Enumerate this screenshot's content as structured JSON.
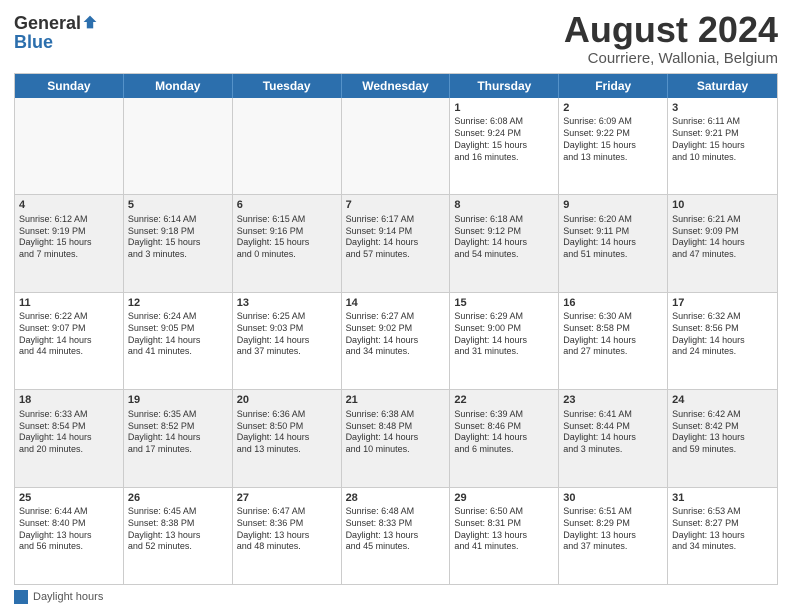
{
  "logo": {
    "general": "General",
    "blue": "Blue"
  },
  "title": {
    "month_year": "August 2024",
    "location": "Courriere, Wallonia, Belgium"
  },
  "header_days": [
    "Sunday",
    "Monday",
    "Tuesday",
    "Wednesday",
    "Thursday",
    "Friday",
    "Saturday"
  ],
  "weeks": [
    [
      {
        "day": "",
        "info": "",
        "empty": true
      },
      {
        "day": "",
        "info": "",
        "empty": true
      },
      {
        "day": "",
        "info": "",
        "empty": true
      },
      {
        "day": "",
        "info": "",
        "empty": true
      },
      {
        "day": "1",
        "info": "Sunrise: 6:08 AM\nSunset: 9:24 PM\nDaylight: 15 hours\nand 16 minutes."
      },
      {
        "day": "2",
        "info": "Sunrise: 6:09 AM\nSunset: 9:22 PM\nDaylight: 15 hours\nand 13 minutes."
      },
      {
        "day": "3",
        "info": "Sunrise: 6:11 AM\nSunset: 9:21 PM\nDaylight: 15 hours\nand 10 minutes."
      }
    ],
    [
      {
        "day": "4",
        "info": "Sunrise: 6:12 AM\nSunset: 9:19 PM\nDaylight: 15 hours\nand 7 minutes.",
        "shade": true
      },
      {
        "day": "5",
        "info": "Sunrise: 6:14 AM\nSunset: 9:18 PM\nDaylight: 15 hours\nand 3 minutes.",
        "shade": true
      },
      {
        "day": "6",
        "info": "Sunrise: 6:15 AM\nSunset: 9:16 PM\nDaylight: 15 hours\nand 0 minutes.",
        "shade": true
      },
      {
        "day": "7",
        "info": "Sunrise: 6:17 AM\nSunset: 9:14 PM\nDaylight: 14 hours\nand 57 minutes.",
        "shade": true
      },
      {
        "day": "8",
        "info": "Sunrise: 6:18 AM\nSunset: 9:12 PM\nDaylight: 14 hours\nand 54 minutes.",
        "shade": true
      },
      {
        "day": "9",
        "info": "Sunrise: 6:20 AM\nSunset: 9:11 PM\nDaylight: 14 hours\nand 51 minutes.",
        "shade": true
      },
      {
        "day": "10",
        "info": "Sunrise: 6:21 AM\nSunset: 9:09 PM\nDaylight: 14 hours\nand 47 minutes.",
        "shade": true
      }
    ],
    [
      {
        "day": "11",
        "info": "Sunrise: 6:22 AM\nSunset: 9:07 PM\nDaylight: 14 hours\nand 44 minutes."
      },
      {
        "day": "12",
        "info": "Sunrise: 6:24 AM\nSunset: 9:05 PM\nDaylight: 14 hours\nand 41 minutes."
      },
      {
        "day": "13",
        "info": "Sunrise: 6:25 AM\nSunset: 9:03 PM\nDaylight: 14 hours\nand 37 minutes."
      },
      {
        "day": "14",
        "info": "Sunrise: 6:27 AM\nSunset: 9:02 PM\nDaylight: 14 hours\nand 34 minutes."
      },
      {
        "day": "15",
        "info": "Sunrise: 6:29 AM\nSunset: 9:00 PM\nDaylight: 14 hours\nand 31 minutes."
      },
      {
        "day": "16",
        "info": "Sunrise: 6:30 AM\nSunset: 8:58 PM\nDaylight: 14 hours\nand 27 minutes."
      },
      {
        "day": "17",
        "info": "Sunrise: 6:32 AM\nSunset: 8:56 PM\nDaylight: 14 hours\nand 24 minutes."
      }
    ],
    [
      {
        "day": "18",
        "info": "Sunrise: 6:33 AM\nSunset: 8:54 PM\nDaylight: 14 hours\nand 20 minutes.",
        "shade": true
      },
      {
        "day": "19",
        "info": "Sunrise: 6:35 AM\nSunset: 8:52 PM\nDaylight: 14 hours\nand 17 minutes.",
        "shade": true
      },
      {
        "day": "20",
        "info": "Sunrise: 6:36 AM\nSunset: 8:50 PM\nDaylight: 14 hours\nand 13 minutes.",
        "shade": true
      },
      {
        "day": "21",
        "info": "Sunrise: 6:38 AM\nSunset: 8:48 PM\nDaylight: 14 hours\nand 10 minutes.",
        "shade": true
      },
      {
        "day": "22",
        "info": "Sunrise: 6:39 AM\nSunset: 8:46 PM\nDaylight: 14 hours\nand 6 minutes.",
        "shade": true
      },
      {
        "day": "23",
        "info": "Sunrise: 6:41 AM\nSunset: 8:44 PM\nDaylight: 14 hours\nand 3 minutes.",
        "shade": true
      },
      {
        "day": "24",
        "info": "Sunrise: 6:42 AM\nSunset: 8:42 PM\nDaylight: 13 hours\nand 59 minutes.",
        "shade": true
      }
    ],
    [
      {
        "day": "25",
        "info": "Sunrise: 6:44 AM\nSunset: 8:40 PM\nDaylight: 13 hours\nand 56 minutes."
      },
      {
        "day": "26",
        "info": "Sunrise: 6:45 AM\nSunset: 8:38 PM\nDaylight: 13 hours\nand 52 minutes."
      },
      {
        "day": "27",
        "info": "Sunrise: 6:47 AM\nSunset: 8:36 PM\nDaylight: 13 hours\nand 48 minutes."
      },
      {
        "day": "28",
        "info": "Sunrise: 6:48 AM\nSunset: 8:33 PM\nDaylight: 13 hours\nand 45 minutes."
      },
      {
        "day": "29",
        "info": "Sunrise: 6:50 AM\nSunset: 8:31 PM\nDaylight: 13 hours\nand 41 minutes."
      },
      {
        "day": "30",
        "info": "Sunrise: 6:51 AM\nSunset: 8:29 PM\nDaylight: 13 hours\nand 37 minutes."
      },
      {
        "day": "31",
        "info": "Sunrise: 6:53 AM\nSunset: 8:27 PM\nDaylight: 13 hours\nand 34 minutes."
      }
    ]
  ],
  "footer": {
    "legend_label": "Daylight hours"
  }
}
